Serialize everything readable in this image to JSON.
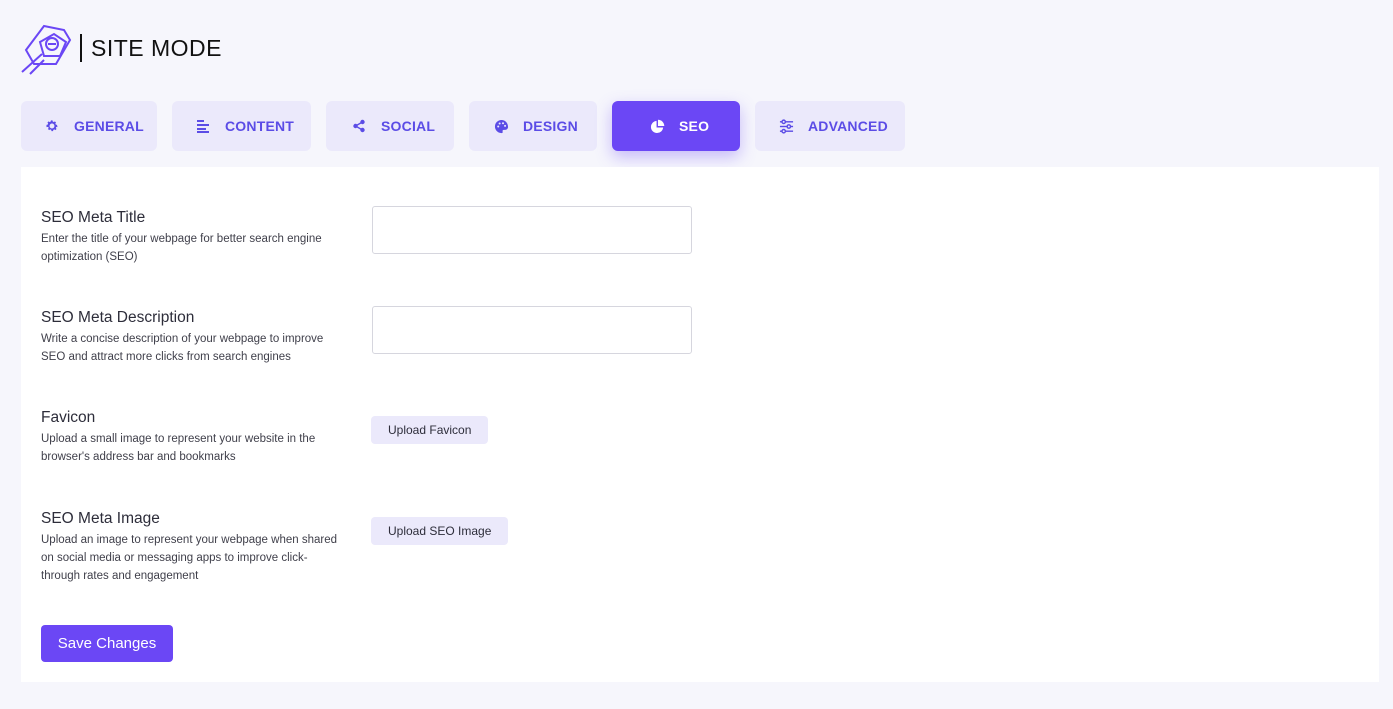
{
  "brand": {
    "name": "SITE MODE",
    "logo_icon": "site-mode-logo",
    "accent_color": "#6b47f5"
  },
  "tabs": [
    {
      "label": "GENERAL",
      "icon": "gear-icon",
      "active": false
    },
    {
      "label": "CONTENT",
      "icon": "align-left-icon",
      "active": false
    },
    {
      "label": "SOCIAL",
      "icon": "share-icon",
      "active": false
    },
    {
      "label": "DESIGN",
      "icon": "palette-icon",
      "active": false
    },
    {
      "label": "SEO",
      "icon": "pie-chart-icon",
      "active": true
    },
    {
      "label": "ADVANCED",
      "icon": "sliders-icon",
      "active": false
    }
  ],
  "seo": {
    "meta_title": {
      "label": "SEO Meta Title",
      "description": "Enter the title of your webpage for better search engine optimization (SEO)",
      "value": ""
    },
    "meta_description": {
      "label": "SEO Meta Description",
      "description": "Write a concise description of your webpage to improve SEO and attract more clicks from search engines",
      "value": ""
    },
    "favicon": {
      "label": "Favicon",
      "description": "Upload a small image to represent your website in the browser's address bar and bookmarks",
      "button": "Upload Favicon"
    },
    "meta_image": {
      "label": "SEO Meta Image",
      "description": "Upload an image to represent your webpage when shared on social media or messaging apps to improve click-through rates and engagement",
      "button": "Upload SEO Image"
    }
  },
  "actions": {
    "save_label": "Save Changes"
  }
}
